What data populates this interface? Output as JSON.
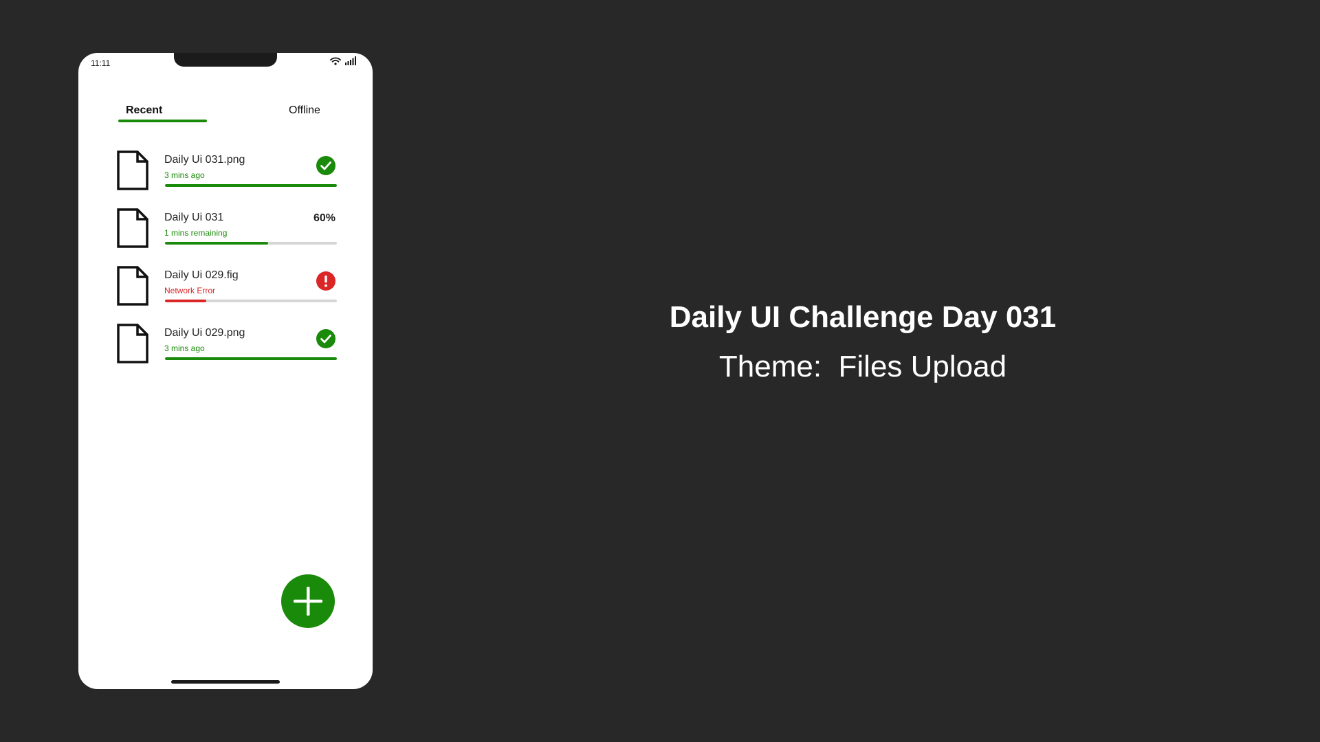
{
  "status_bar": {
    "time": "11:11"
  },
  "tabs": [
    {
      "label": "Recent",
      "active": true
    },
    {
      "label": "Offline",
      "active": false
    }
  ],
  "files": [
    {
      "name": "Daily Ui 031.png",
      "subtitle": "3 mins ago",
      "state": "complete",
      "progress": 100
    },
    {
      "name": "Daily Ui 031",
      "subtitle": "1 mins remaining",
      "state": "uploading",
      "progress": 60,
      "percent_label": "60%"
    },
    {
      "name": "Daily Ui 029.fig",
      "subtitle": "Network Error",
      "state": "error",
      "progress": 24
    },
    {
      "name": "Daily Ui 029.png",
      "subtitle": "3 mins ago",
      "state": "complete",
      "progress": 100
    }
  ],
  "fab": {
    "icon": "plus-icon"
  },
  "headline": "Daily UI Challenge Day 031",
  "subheadline": "Theme:  Files Upload",
  "colors": {
    "background": "#282828",
    "accent_green": "#1a8a0a",
    "error_red": "#d92626",
    "track_gray": "#d6d6d6"
  }
}
